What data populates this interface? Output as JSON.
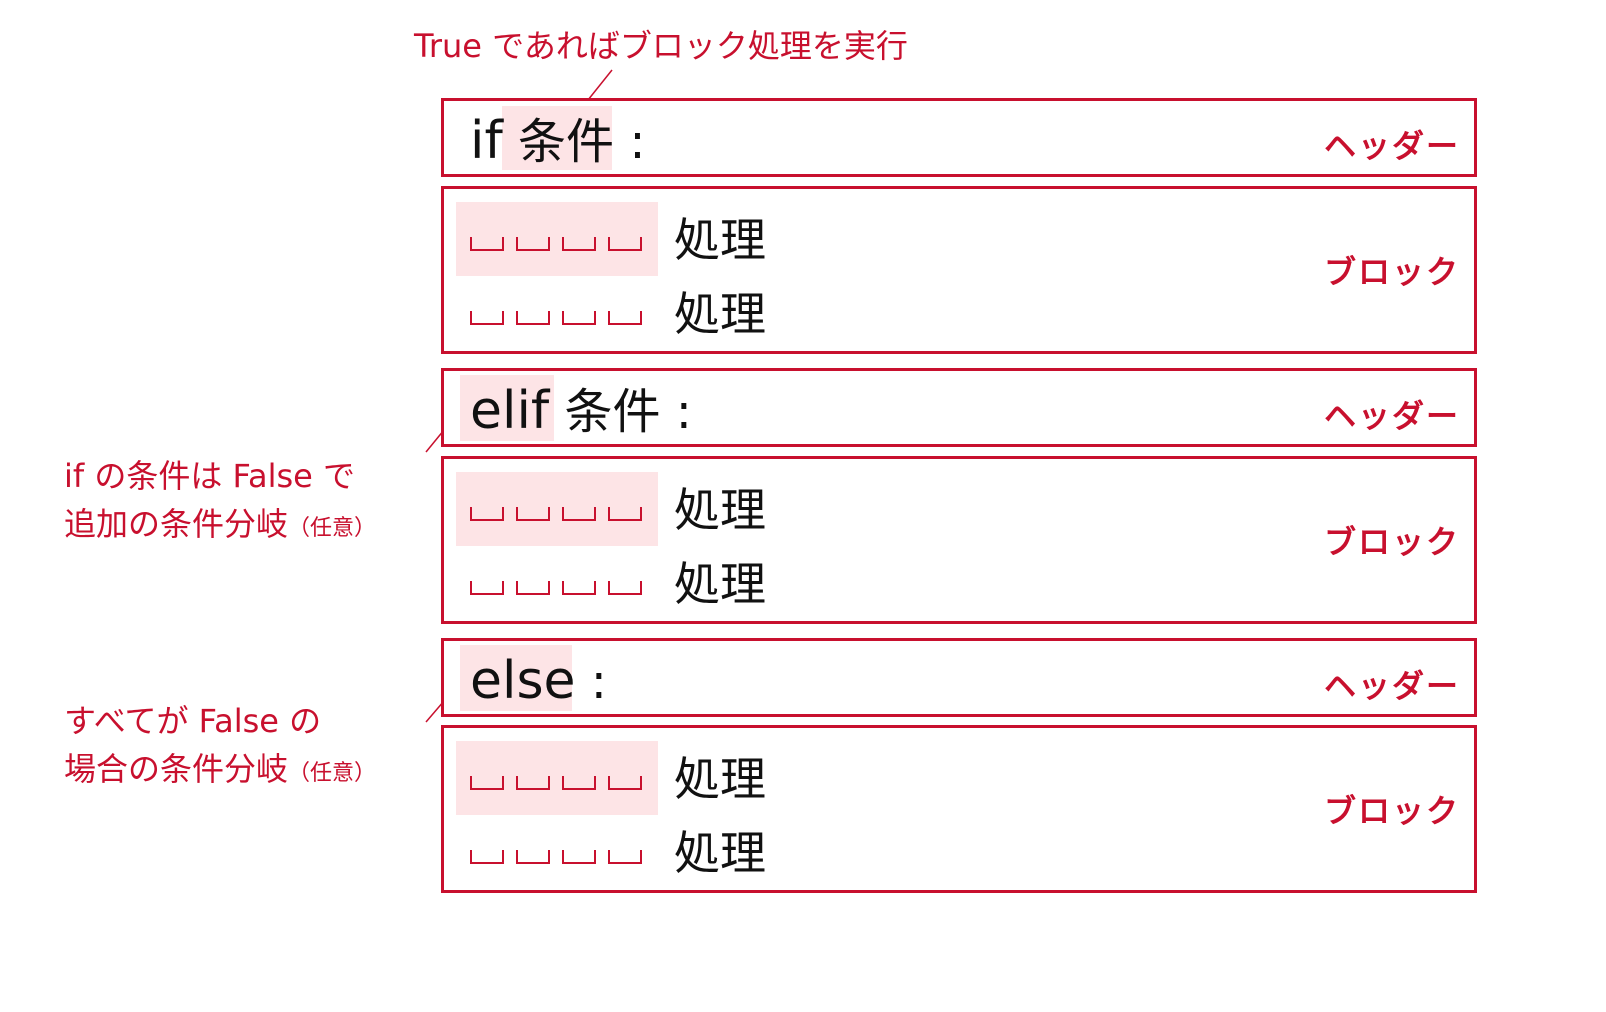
{
  "colors": {
    "accent": "#c8102e",
    "highlight": "#fde4e6"
  },
  "annotations": {
    "top": "True であればブロック処理を実行",
    "elif_note_line1": "if の条件は False で",
    "elif_note_line2": "追加の条件分岐",
    "elif_note_suffix": "（任意）",
    "else_note_line1": "すべてが False の",
    "else_note_line2": "場合の条件分岐",
    "else_note_suffix": "（任意）"
  },
  "labels": {
    "header": "ヘッダー",
    "block": "ブロック"
  },
  "sections": [
    {
      "keyword": "if",
      "condition": "条件",
      "colon": ":",
      "body": [
        "処理",
        "処理"
      ]
    },
    {
      "keyword": "elif",
      "condition": "条件",
      "colon": ":",
      "body": [
        "処理",
        "処理"
      ]
    },
    {
      "keyword": "else",
      "condition": "",
      "colon": ":",
      "body": [
        "処理",
        "処理"
      ]
    }
  ]
}
